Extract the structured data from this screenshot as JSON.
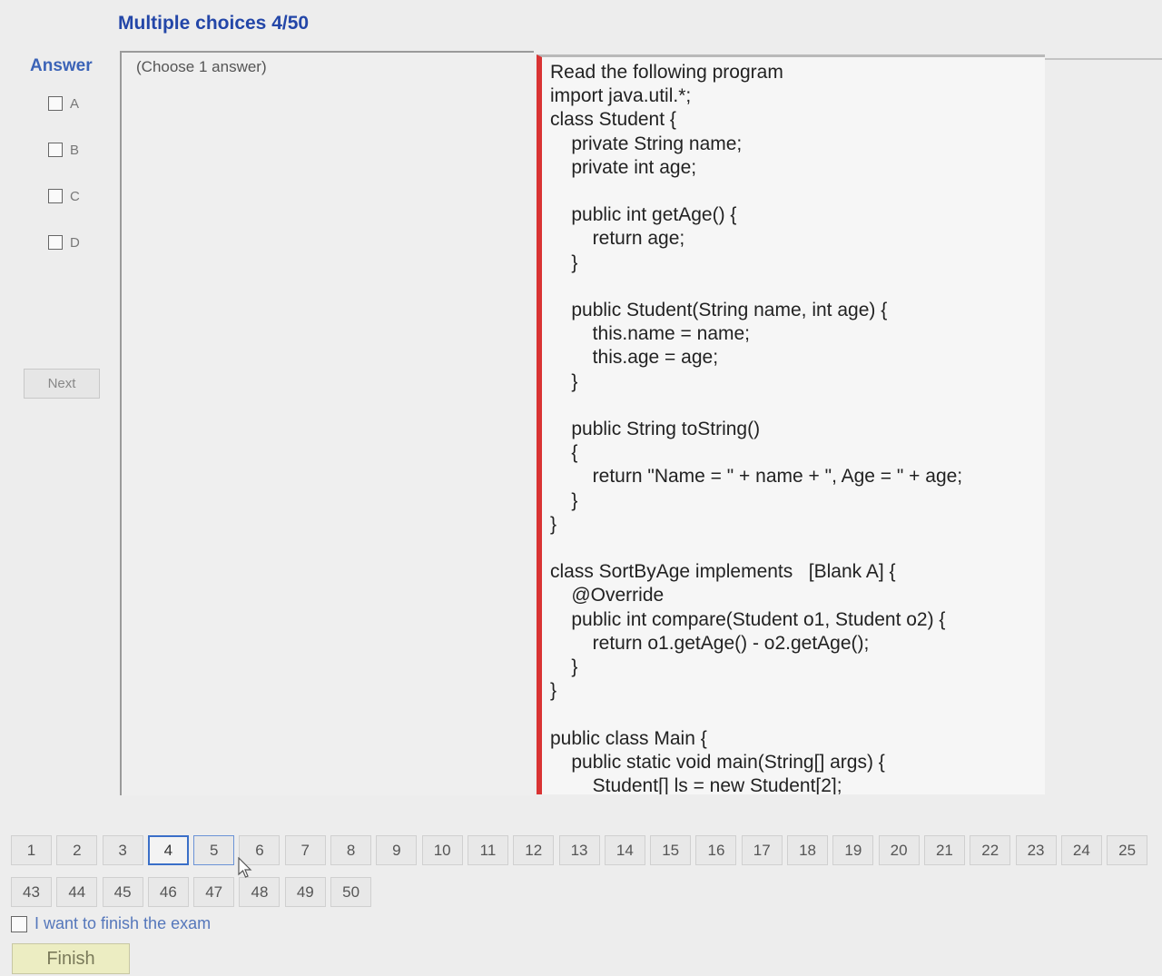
{
  "header": {
    "title": "Multiple choices 4/50"
  },
  "answer": {
    "label": "Answer",
    "hint": "(Choose 1 answer)",
    "options": [
      {
        "label": "A",
        "checked": false
      },
      {
        "label": "B",
        "checked": false
      },
      {
        "label": "C",
        "checked": false
      },
      {
        "label": "D",
        "checked": false
      }
    ],
    "next_label": "Next"
  },
  "question": {
    "lines": [
      "Read the following program",
      "import java.util.*;",
      "class Student {",
      "    private String name;",
      "    private int age;",
      "",
      "    public int getAge() {",
      "        return age;",
      "    }",
      "",
      "    public Student(String name, int age) {",
      "        this.name = name;",
      "        this.age = age;",
      "    }",
      "",
      "    public String toString()",
      "    {",
      "        return \"Name = \" + name + \", Age = \" + age;",
      "    }",
      "}",
      "",
      "class SortByAge implements   [Blank A] {",
      "    @Override",
      "    public int compare(Student o1, Student o2) {",
      "        return o1.getAge() - o2.getAge();",
      "    }",
      "}",
      "",
      "public class Main {",
      "    public static void main(String[] args) {",
      "        Student[] ls = new Student[2];"
    ]
  },
  "pagination": {
    "current": "4",
    "hovered": "5",
    "row1": [
      "1",
      "2",
      "3",
      "4",
      "5",
      "6",
      "7",
      "8",
      "9",
      "10",
      "11",
      "12",
      "13",
      "14",
      "15",
      "16",
      "17",
      "18",
      "19",
      "20",
      "21",
      "22",
      "23",
      "24",
      "25"
    ],
    "row2": [
      "43",
      "44",
      "45",
      "46",
      "47",
      "48",
      "49",
      "50"
    ]
  },
  "finish": {
    "checkbox_label": "I want to finish the exam",
    "button_label": "Finish"
  },
  "colors": {
    "title": "#2346a8",
    "question_border": "#d93333",
    "current_page_border": "#3a6fc8",
    "finish_button": "#ecedc2"
  }
}
